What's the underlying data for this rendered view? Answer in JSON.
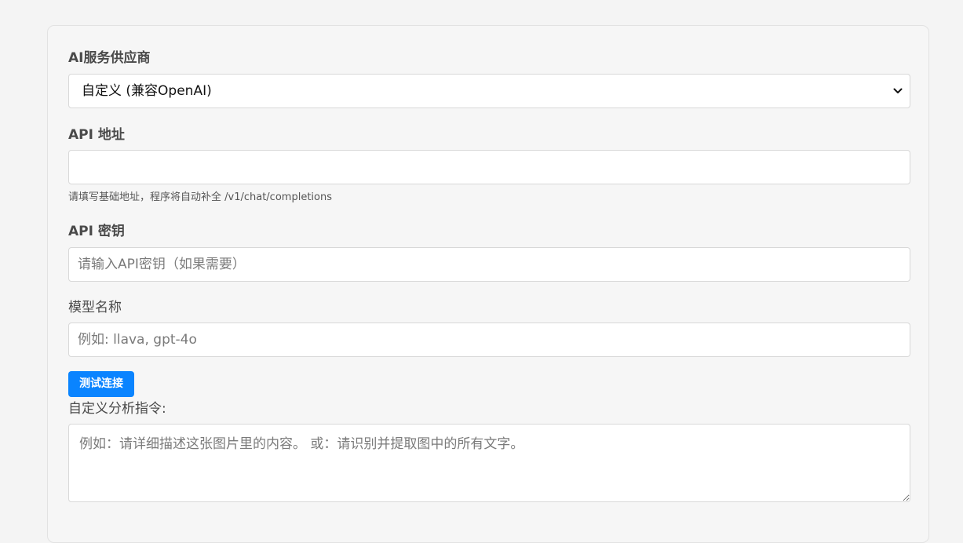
{
  "provider": {
    "label": "AI服务供应商",
    "selected": "自定义 (兼容OpenAI)"
  },
  "api_url": {
    "label": "API 地址",
    "value": "",
    "placeholder": "",
    "hint": "请填写基础地址，程序将自动补全 /v1/chat/completions"
  },
  "api_key": {
    "label": "API 密钥",
    "placeholder": "请输入API密钥（如果需要）"
  },
  "model": {
    "label": "模型名称",
    "placeholder": "例如: llava, gpt-4o"
  },
  "test_button": {
    "label": "测试连接",
    "color": "#0a84ff"
  },
  "instructions": {
    "label": "自定义分析指令:",
    "placeholder": "例如：请详细描述这张图片里的内容。 或：请识别并提取图中的所有文字。"
  },
  "icons": {
    "select_arrow": "chevron-down-icon",
    "resize_handle": "resize-grip-icon"
  }
}
